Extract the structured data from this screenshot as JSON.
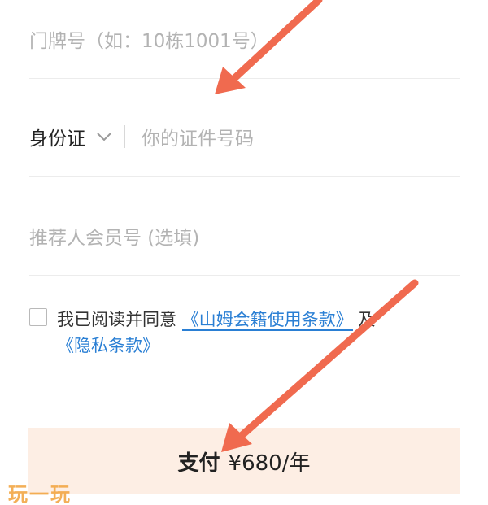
{
  "form": {
    "door_placeholder": "门牌号（如：10栋1001号）",
    "id_type": "身份证",
    "id_placeholder": "你的证件号码",
    "referrer_placeholder": "推荐人会员号 (选填)"
  },
  "agreement": {
    "prefix": "我已阅读并同意",
    "terms_link": "《山姆会籍使用条款》",
    "and": "及",
    "privacy_link": "《隐私条款》"
  },
  "pay_button": {
    "label": "支付",
    "price": "¥680/年"
  },
  "watermark": "玩一玩",
  "colors": {
    "accent_link": "#2a7fd4",
    "pay_button_bg": "#fdeee4",
    "arrow": "#f06a4f",
    "watermark": "#f2a23a"
  }
}
